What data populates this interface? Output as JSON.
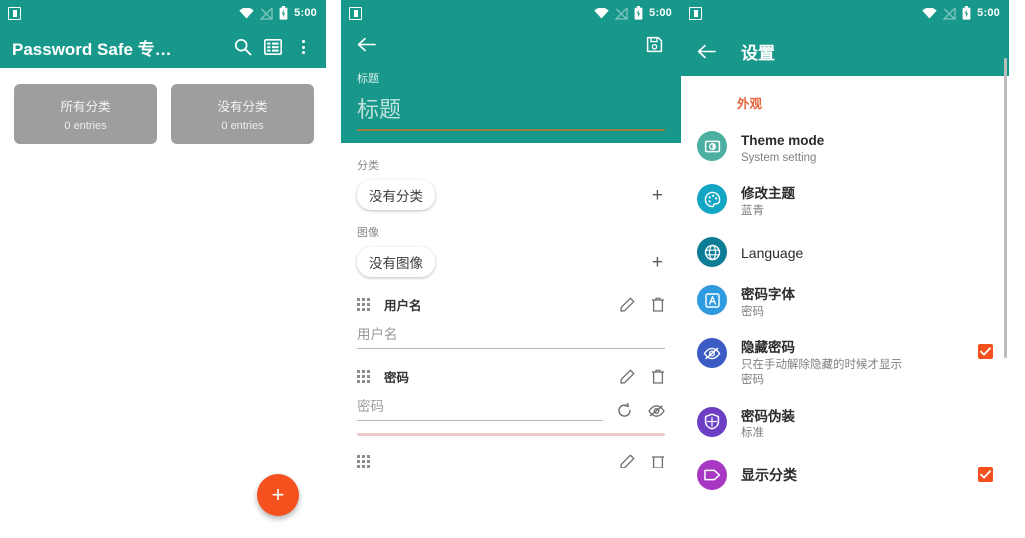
{
  "statusbar": {
    "time": "5:00",
    "icons": [
      "app-square-icon",
      "wifi-icon",
      "signal-off-icon",
      "battery-icon"
    ]
  },
  "colors": {
    "teal": "#17988A",
    "accent_orange": "#F4511E",
    "section_header": "#E8643C",
    "card_grey": "#9E9E9E",
    "title_underline": "#9A7E48",
    "pink_rule": "#F0C8C8"
  },
  "panel_list": {
    "appbar": {
      "title": "Password Safe 专…",
      "search_icon": "search-icon",
      "view_icon": "view-list-icon",
      "overflow_icon": "overflow-menu-icon"
    },
    "categories": [
      {
        "name": "所有分类",
        "count": "0 entries"
      },
      {
        "name": "没有分类",
        "count": "0 entries"
      }
    ],
    "fab_label": "+"
  },
  "panel_edit": {
    "appbar": {
      "back_icon": "back-arrow-icon",
      "save_icon": "save-icon"
    },
    "title_field": {
      "label": "标题",
      "placeholder": "标题",
      "value": ""
    },
    "category": {
      "label": "分类",
      "chip": "没有分类",
      "add": "+"
    },
    "image": {
      "label": "图像",
      "chip": "没有图像",
      "add": "+"
    },
    "rows": [
      {
        "name": "用户名",
        "placeholder": "用户名",
        "value": "",
        "edit_icon": "pencil-icon",
        "delete_icon": "trash-icon",
        "drag_icon": "drag-handle-icon",
        "extra_icons": []
      },
      {
        "name": "密码",
        "placeholder": "密码",
        "value": "",
        "edit_icon": "pencil-icon",
        "delete_icon": "trash-icon",
        "drag_icon": "drag-handle-icon",
        "extra_icons": [
          "refresh-icon",
          "eye-off-icon"
        ]
      }
    ]
  },
  "panel_settings": {
    "appbar": {
      "back_icon": "back-arrow-icon",
      "title": "设置"
    },
    "section": "外观",
    "items": [
      {
        "title": "Theme mode",
        "subtitle": "System setting",
        "icon": "brightness-icon",
        "icon_color": "#4DAFA2",
        "checkbox": null,
        "bold": true
      },
      {
        "title": "修改主题",
        "subtitle": "蓝青",
        "icon": "palette-icon",
        "icon_color": "#12A5C4",
        "checkbox": null,
        "bold": true
      },
      {
        "title": "Language",
        "subtitle": "",
        "icon": "globe-icon",
        "icon_color": "#0B7E96",
        "checkbox": null,
        "bold": false
      },
      {
        "title": "密码字体",
        "subtitle": "密码",
        "icon": "font-icon",
        "icon_color": "#2E9BE0",
        "checkbox": null,
        "bold": true
      },
      {
        "title": "隐藏密码",
        "subtitle": "只在手动解除隐藏的时候才显示\n密码",
        "icon": "eye-off-icon",
        "icon_color": "#3D5BC4",
        "checkbox": true,
        "bold": true
      },
      {
        "title": "密码伪装",
        "subtitle": "标准",
        "icon": "shield-icon",
        "icon_color": "#6C3FC4",
        "checkbox": null,
        "bold": true
      },
      {
        "title": "显示分类",
        "subtitle": "",
        "icon": "tag-icon",
        "icon_color": "#A838C4",
        "checkbox": true,
        "bold": true
      }
    ]
  }
}
